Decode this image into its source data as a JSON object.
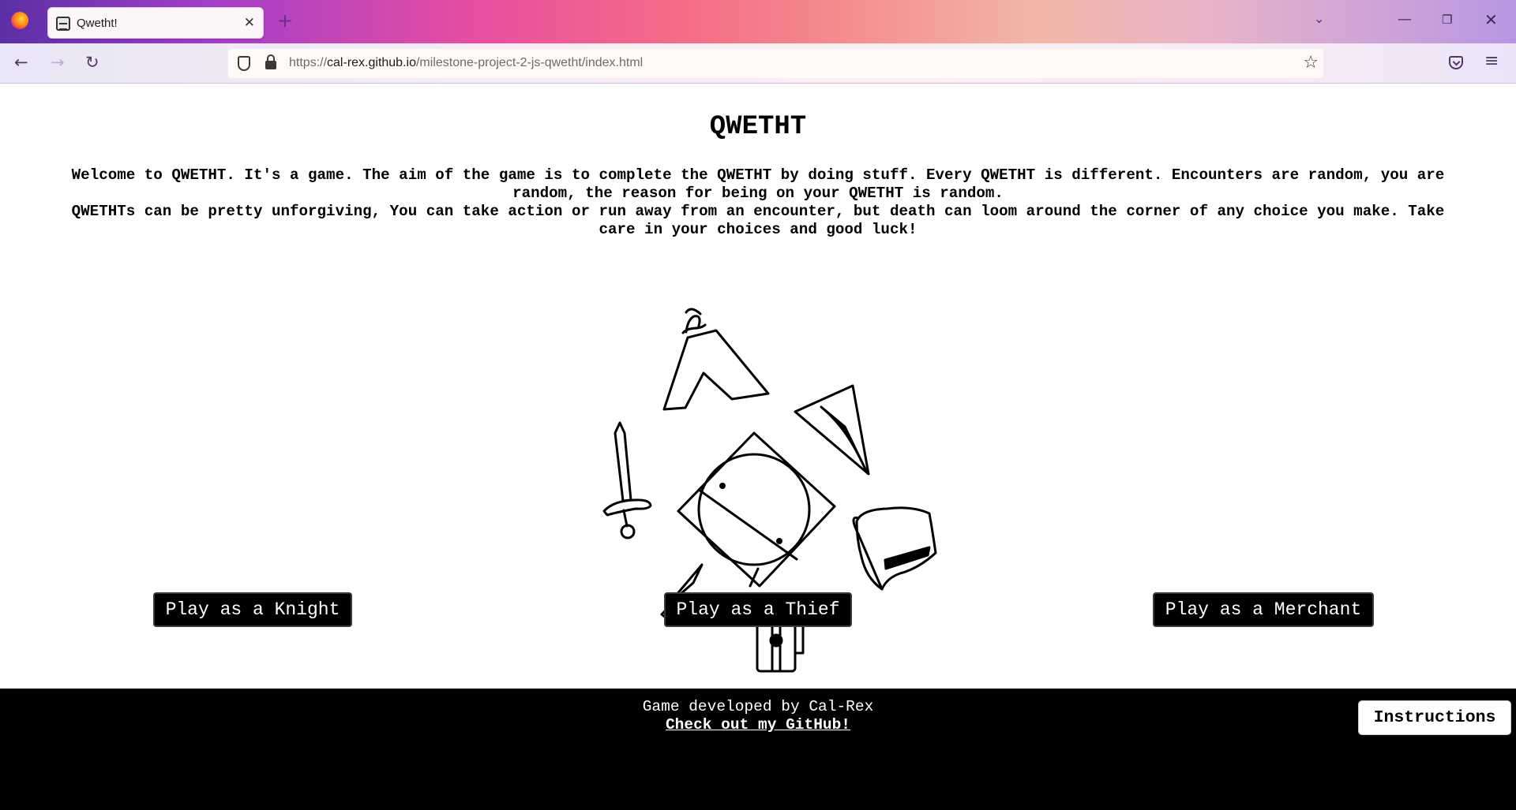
{
  "browser": {
    "tab_title": "Qwetht!",
    "tab_close": "✕",
    "new_tab": "+",
    "tab_list": "⌄",
    "url_protocol": "https://",
    "url_host": "cal-rex.github.io",
    "url_path": "/milestone-project-2-js-qwetht/index.html",
    "bookmark_glyph": "☆",
    "menu_glyph": "≡",
    "back_glyph": "←",
    "forward_glyph": "→",
    "reload_glyph": "↻",
    "win_min": "—",
    "win_max": "❐",
    "win_close": "✕"
  },
  "page": {
    "title": "QWETHT",
    "intro_1": "Welcome to QWETHT. It's a game. The aim of the game is to complete the QWETHT by doing stuff. Every QWETHT is different. Encounters are random, you are random, the reason for being on your QWETHT is random.",
    "intro_2": "QWETHTs can be pretty unforgiving, You can take action or run away from an encounter, but death can loom around the corner of any choice you make. Take care in your choices and good luck!",
    "buttons": {
      "knight": "Play as a Knight",
      "thief": "Play as a Thief",
      "merchant": "Play as a Merchant"
    }
  },
  "footer": {
    "credit": "Game developed by Cal-Rex",
    "github_link": "Check out my GitHub!",
    "instructions": "Instructions"
  },
  "icons": [
    "firefox-logo",
    "shield-icon",
    "lock-icon",
    "star-icon",
    "pocket-icon",
    "menu-icon"
  ]
}
